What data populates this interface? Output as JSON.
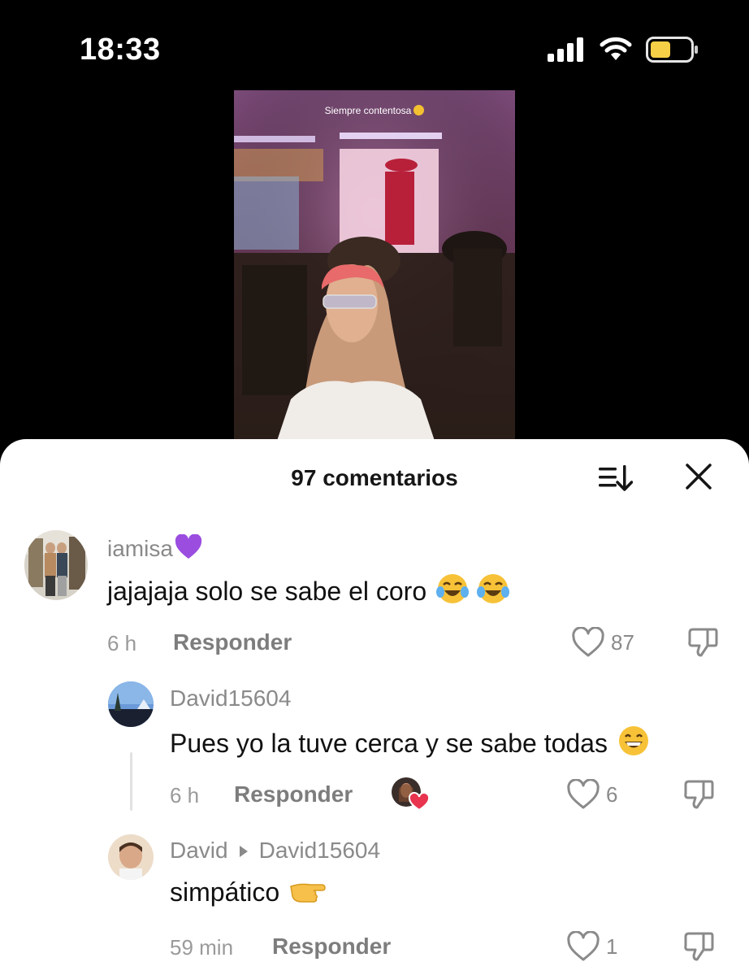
{
  "status": {
    "time": "18:33"
  },
  "video": {
    "caption": "Siempre contentosa"
  },
  "sheet": {
    "title": "97 comentarios"
  },
  "comments": [
    {
      "username": "iamisa",
      "text": "jajajaja solo se sabe el coro",
      "time": "6 h",
      "reply_label": "Responder",
      "likes": "87"
    },
    {
      "username": "David15604",
      "text": "Pues yo la tuve cerca y se sabe todas",
      "time": "6 h",
      "reply_label": "Responder",
      "likes": "6"
    },
    {
      "username": "David",
      "reply_to": "David15604",
      "text": "simpático",
      "time": "59 min",
      "reply_label": "Responder",
      "likes": "1"
    }
  ],
  "colors": {
    "heart": "#e8344e",
    "battery": "#f6d046"
  }
}
